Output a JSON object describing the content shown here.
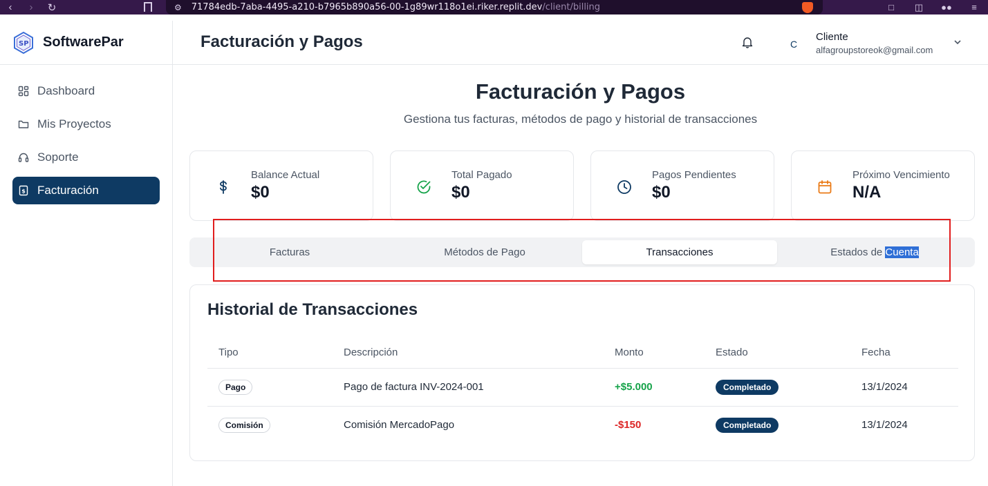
{
  "browser": {
    "url_host": "71784edb-7aba-4495-a210-b7965b890a56-00-1g89wr118o1ei.riker.replit.dev",
    "url_path": "/client/billing"
  },
  "sidebar": {
    "brand": "SoftwarePar",
    "items": [
      {
        "label": "Dashboard",
        "icon": "dashboard-icon"
      },
      {
        "label": "Mis Proyectos",
        "icon": "folder-icon"
      },
      {
        "label": "Soporte",
        "icon": "headset-icon"
      },
      {
        "label": "Facturación",
        "icon": "invoice-icon",
        "active": true
      }
    ]
  },
  "header": {
    "title": "Facturación y Pagos",
    "avatar_initial": "C",
    "user_name": "Cliente",
    "user_email": "alfagroupstoreok@gmail.com"
  },
  "main": {
    "title": "Facturación y Pagos",
    "subtitle": "Gestiona tus facturas, métodos de pago y historial de transacciones",
    "stats": [
      {
        "label": "Balance Actual",
        "value": "$0",
        "icon": "dollar-icon",
        "color": "#0e3a63"
      },
      {
        "label": "Total Pagado",
        "value": "$0",
        "icon": "check-circle-icon",
        "color": "#16a34a"
      },
      {
        "label": "Pagos Pendientes",
        "value": "$0",
        "icon": "clock-icon",
        "color": "#0e3a63"
      },
      {
        "label": "Próximo Vencimiento",
        "value": "N/A",
        "icon": "calendar-icon",
        "color": "#ea7a16"
      }
    ],
    "tabs": [
      {
        "label": "Facturas"
      },
      {
        "label": "Métodos de Pago"
      },
      {
        "label": "Transacciones",
        "active": true
      },
      {
        "label_prefix": "Estados de ",
        "label_selected": "Cuenta"
      }
    ],
    "transactions": {
      "title": "Historial de Transacciones",
      "columns": [
        "Tipo",
        "Descripción",
        "Monto",
        "Estado",
        "Fecha"
      ],
      "rows": [
        {
          "type": "Pago",
          "description": "Pago de factura INV-2024-001",
          "amount": "+$5.000",
          "amount_color": "#16a34a",
          "status": "Completado",
          "date": "13/1/2024"
        },
        {
          "type": "Comisión",
          "description": "Comisión MercadoPago",
          "amount": "-$150",
          "amount_color": "#dc2626",
          "status": "Completado",
          "date": "13/1/2024"
        }
      ]
    }
  }
}
